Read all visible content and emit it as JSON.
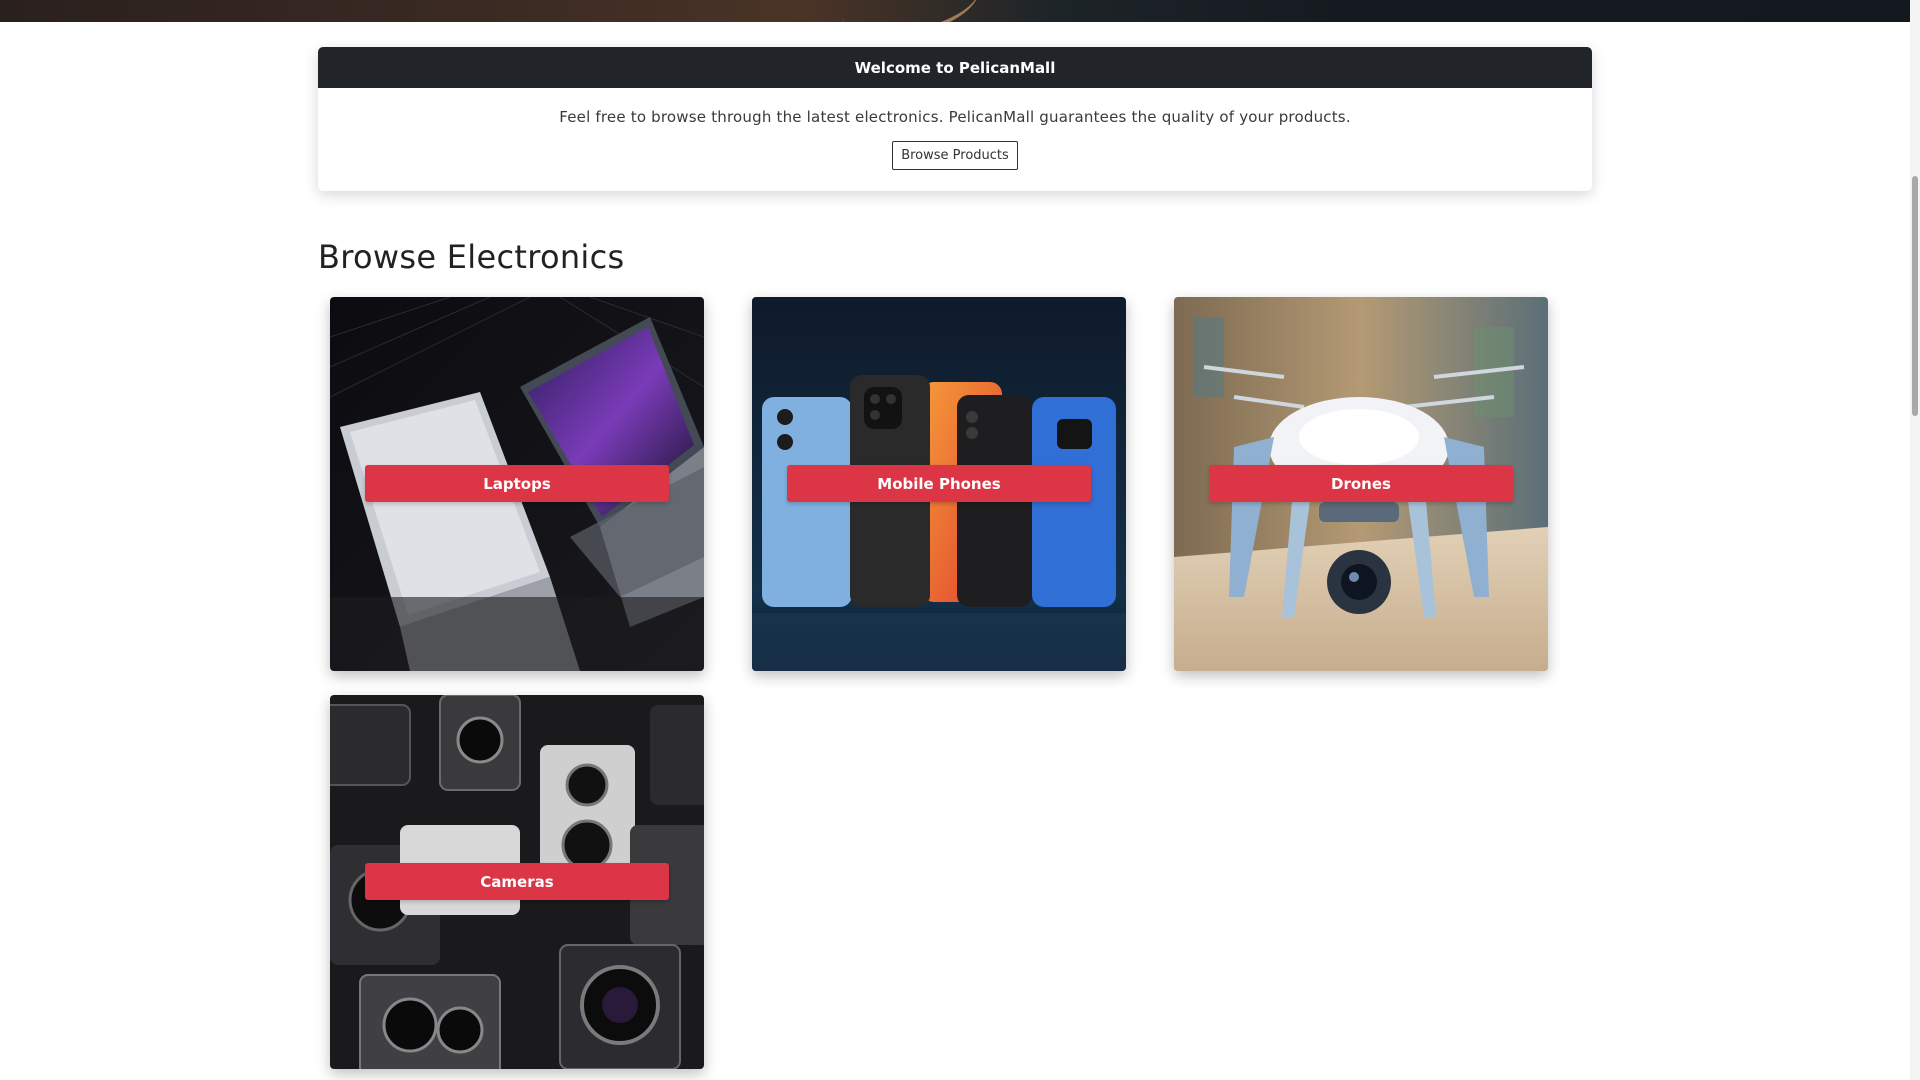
{
  "welcome": {
    "title": "Welcome to PelicanMall",
    "text": "Feel free to browse through the latest electronics. PelicanMall guarantees the quality of your products.",
    "button_label": "Browse Products"
  },
  "section": {
    "title": "Browse Electronics"
  },
  "categories": [
    {
      "label": "Laptops"
    },
    {
      "label": "Mobile Phones"
    },
    {
      "label": "Drones"
    },
    {
      "label": "Cameras"
    }
  ],
  "colors": {
    "accent": "#dc3545",
    "header_dark": "#212529"
  }
}
